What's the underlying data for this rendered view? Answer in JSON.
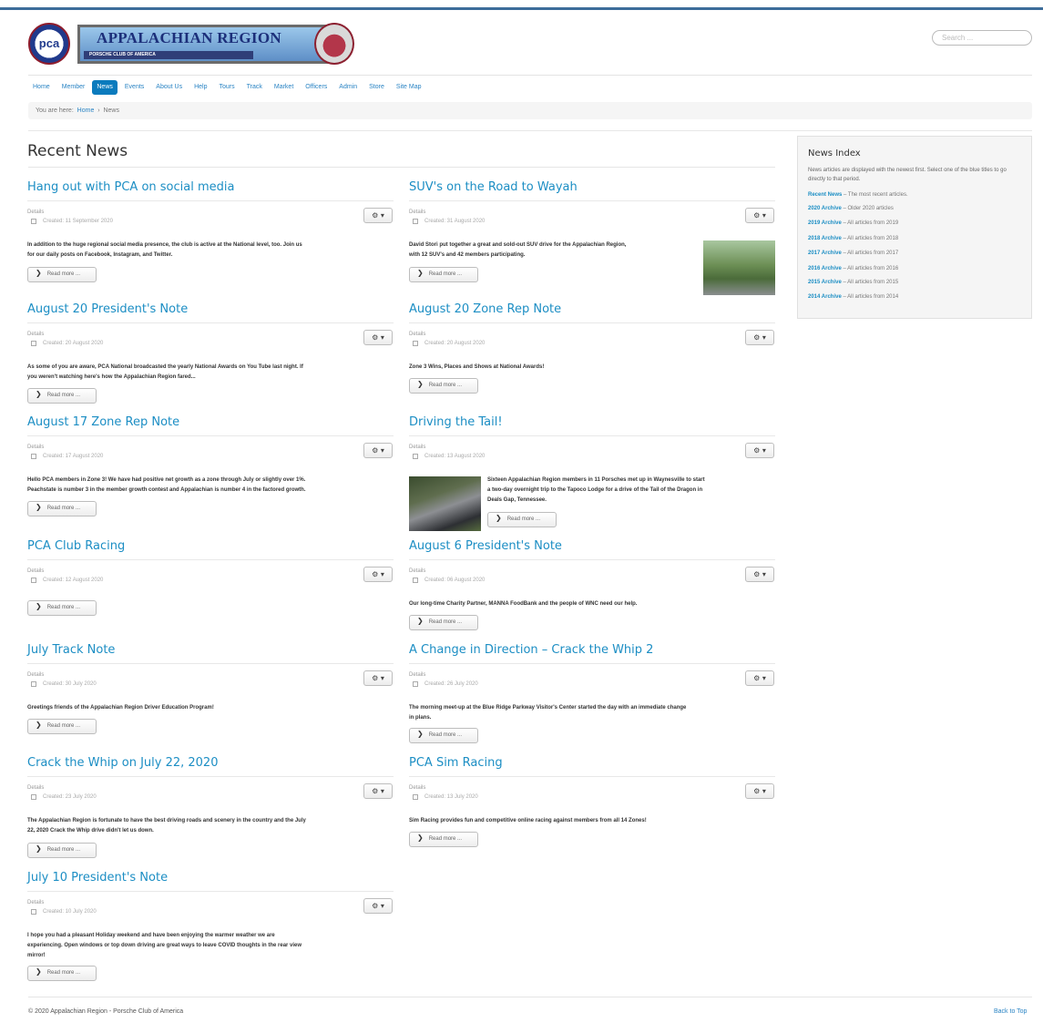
{
  "header": {
    "pca_logo_text": "pca",
    "banner_title": "APPALACHIAN REGION",
    "banner_subtitle": "PORSCHE CLUB OF AMERICA",
    "search_placeholder": "Search ..."
  },
  "nav": {
    "items": [
      "Home",
      "Member",
      "News",
      "Events",
      "About Us",
      "Help",
      "Tours",
      "Track",
      "Market",
      "Officers",
      "Admin",
      "Store",
      "Site Map"
    ],
    "active_index": 2
  },
  "breadcrumb": {
    "prefix": "You are here:",
    "home": "Home",
    "separator": "›",
    "current": "News"
  },
  "page_title": "Recent News",
  "common": {
    "details": "Details",
    "read_more": "Read more ...",
    "gear": "⚙ ▾",
    "chevron": "❯"
  },
  "articles": [
    {
      "title": "Hang out with PCA on social media",
      "created": "Created: 11 September 2020",
      "intro": [
        "In addition to the huge regional social media presence, the club is active at the National level, too. Join us",
        "for our daily posts on Facebook, Instagram, and Twitter."
      ]
    },
    {
      "title": "SUV's on the Road to Wayah",
      "created": "Created: 31 August 2020",
      "intro": [
        "David Stori put together a great and sold-out SUV drive for the Appalachian Region,",
        "with 12 SUV's and 42 members participating."
      ]
    },
    {
      "title": "August 20 President's Note",
      "created": "Created: 20 August 2020",
      "intro": [
        "As some of you are aware, PCA National broadcasted the yearly National Awards on You Tube last night.  If",
        "you weren't watching here's how the Appalachian Region fared..."
      ]
    },
    {
      "title": "August 20 Zone Rep Note",
      "created": "Created: 20 August 2020",
      "intro": [
        "Zone 3 Wins, Places and Shows at National Awards!"
      ]
    },
    {
      "title": "August 17 Zone Rep Note",
      "created": "Created: 17 August 2020",
      "intro": [
        "Hello PCA members in Zone 3! We have had positive net growth as a zone through July or slightly over 1%.",
        "Peachstate is number 3 in the member growth contest and Appalachian is number 4 in the factored growth."
      ]
    },
    {
      "title": "Driving the Tail!",
      "created": "Created: 13 August 2020",
      "intro": [
        "Sixteen Appalachian Region members in 11 Porsches met up in Waynesville to start",
        "a two-day overnight trip to the Tapoco Lodge for a drive of the Tail of the Dragon in",
        "Deals Gap, Tennessee."
      ]
    },
    {
      "title": "PCA Club Racing",
      "created": "Created: 12 August 2020",
      "intro": []
    },
    {
      "title": "August 6 President's Note",
      "created": "Created: 06 August 2020",
      "intro": [
        "Our long-time Charity Partner, MANNA FoodBank and the people of WNC need our help."
      ]
    },
    {
      "title": "July Track Note",
      "created": "Created: 30 July 2020",
      "intro": [
        "Greetings friends of the Appalachian Region Driver Education Program!"
      ]
    },
    {
      "title": "A Change in Direction – Crack the Whip 2",
      "created": "Created: 26 July 2020",
      "intro": [
        "The morning meet-up at the Blue Ridge Parkway Visitor's Center started the day with an immediate change",
        "in plans."
      ]
    },
    {
      "title": "Crack the Whip on July 22, 2020",
      "created": "Created: 23 July 2020",
      "intro": [
        "The Appalachian Region is fortunate to have the best driving roads and scenery in the country and the July",
        "22, 2020 Crack the Whip drive didn't let us down."
      ]
    },
    {
      "title": "PCA Sim Racing",
      "created": "Created: 13 July 2020",
      "intro": [
        "Sim Racing provides fun and competitive online racing against members from all 14 Zones!"
      ]
    },
    {
      "title": "July 10 President's Note",
      "created": "Created: 10 July 2020",
      "intro": [
        "I hope you had a pleasant Holiday weekend and have been enjoying the warmer weather we are",
        "experiencing. Open windows or top down driving are great ways to leave COVID thoughts in the rear view",
        "mirror!"
      ]
    }
  ],
  "sidebar": {
    "title": "News Index",
    "description": "News articles are displayed with the newest first. Select one of the blue titles to go directly to that period.",
    "items": [
      {
        "link": "Recent News",
        "text": " – The most recent articles."
      },
      {
        "link": "2020 Archive",
        "text": " – Older 2020 articles"
      },
      {
        "link": "2019 Archive",
        "text": " – All articles from 2019"
      },
      {
        "link": "2018 Archive",
        "text": " – All articles from 2018"
      },
      {
        "link": "2017 Archive",
        "text": " – All articles from 2017"
      },
      {
        "link": "2016 Archive",
        "text": " – All articles from 2016"
      },
      {
        "link": "2015 Archive",
        "text": " – All articles from 2015"
      },
      {
        "link": "2014 Archive",
        "text": " – All articles from 2014"
      }
    ]
  },
  "footer": {
    "copyright": "© 2020 Appalachian Region - Porsche Club of America",
    "back_to_top": "Back to Top"
  },
  "colors": {
    "link": "#1c8ec4",
    "nav_active": "#0b7bbd",
    "top_line": "#3d6d9a"
  }
}
